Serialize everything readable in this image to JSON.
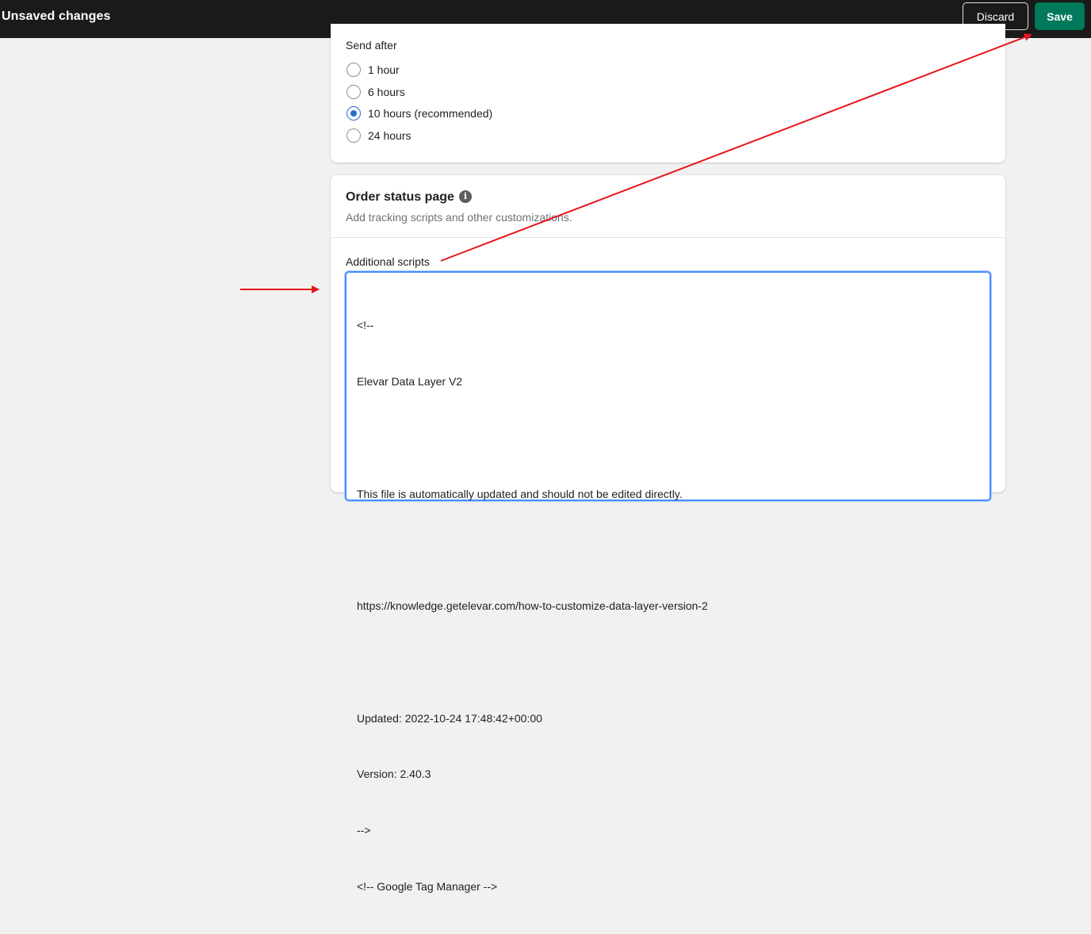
{
  "topbar": {
    "title": "Unsaved changes",
    "discard_label": "Discard",
    "save_label": "Save"
  },
  "send_after": {
    "label": "Send after",
    "options": [
      {
        "label": "1 hour",
        "checked": false
      },
      {
        "label": "6 hours",
        "checked": false
      },
      {
        "label": "10 hours (recommended)",
        "checked": true
      },
      {
        "label": "24 hours",
        "checked": false
      }
    ]
  },
  "order_status": {
    "title": "Order status page",
    "info_icon": "i",
    "subtitle": "Add tracking scripts and other customizations.",
    "scripts_label": "Additional scripts",
    "script_lines": [
      "<!--",
      "Elevar Data Layer V2",
      "",
      "This file is automatically updated and should not be edited directly.",
      "",
      "https://knowledge.getelevar.com/how-to-customize-data-layer-version-2",
      "",
      "Updated: 2022-10-24 17:48:42+00:00",
      "Version: 2.40.3",
      "-->",
      "<!-- Google Tag Manager -->"
    ]
  },
  "colors": {
    "topbar_bg": "#1a1a1a",
    "save_green": "#007a5a",
    "focus_blue": "#458fff",
    "radio_blue": "#2c6ecb",
    "annotation_red": "#e8141b"
  },
  "icons": {
    "info": "info-icon",
    "annotation_arrow": "arrow-icon"
  }
}
